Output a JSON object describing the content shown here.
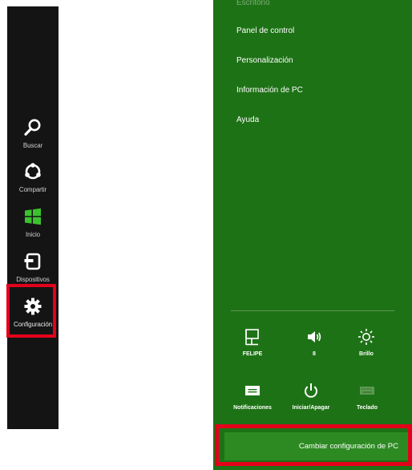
{
  "charms": [
    {
      "label": "Buscar",
      "icon": "search-icon"
    },
    {
      "label": "Compartir",
      "icon": "share-icon"
    },
    {
      "label": "Inicio",
      "icon": "windows-logo-icon"
    },
    {
      "label": "Dispositivos",
      "icon": "devices-icon"
    },
    {
      "label": "Configuración",
      "icon": "gear-icon",
      "selected": true
    }
  ],
  "settings_pane": {
    "menu_items": [
      "Escritorio",
      "Panel de control",
      "Personalización",
      "Información de PC",
      "Ayuda"
    ],
    "quick_tiles": [
      {
        "label": "FELIPE",
        "icon": "network-icon"
      },
      {
        "label": "8",
        "icon": "volume-icon"
      },
      {
        "label": "Brillo",
        "icon": "brightness-icon"
      },
      {
        "label": "Notificaciones",
        "icon": "notifications-icon"
      },
      {
        "label": "Iniciar/Apagar",
        "icon": "power-icon"
      },
      {
        "label": "Teclado",
        "icon": "keyboard-icon"
      }
    ],
    "change_pc_settings_label": "Cambiar configuración de PC"
  },
  "colors": {
    "charms_bg": "#141414",
    "pane_bg": "#1e7216",
    "highlight": "#e3001b",
    "windows_green": "#3cc22f"
  }
}
